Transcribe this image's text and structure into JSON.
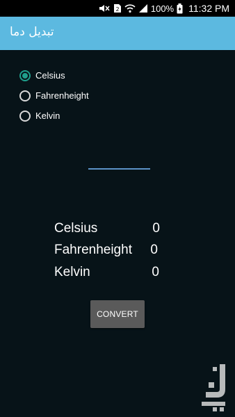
{
  "status_bar": {
    "battery_text": "100%",
    "time": "11:32 PM"
  },
  "app_bar": {
    "title": "تبدیل دما",
    "background_color": "#5cb9e0"
  },
  "unit_options": [
    {
      "label": "Celsius",
      "selected": true
    },
    {
      "label": "Fahrenheight",
      "selected": false
    },
    {
      "label": "Kelvin",
      "selected": false
    }
  ],
  "temperature_input": {
    "value": "",
    "placeholder": ""
  },
  "results": [
    {
      "label": "Celsius",
      "value": "0"
    },
    {
      "label": "Fahrenheight",
      "value": "0"
    },
    {
      "label": "Kelvin",
      "value": "0"
    }
  ],
  "convert_button": {
    "label": "CONVERT"
  },
  "colors": {
    "background": "#071318",
    "accent": "#1f9f8c",
    "input_underline": "#5c93c8",
    "button": "#5a5a5a"
  },
  "icons": [
    "mute-icon",
    "sim-icon",
    "wifi-icon",
    "signal-icon",
    "battery-icon",
    "app-store-logo-icon"
  ]
}
